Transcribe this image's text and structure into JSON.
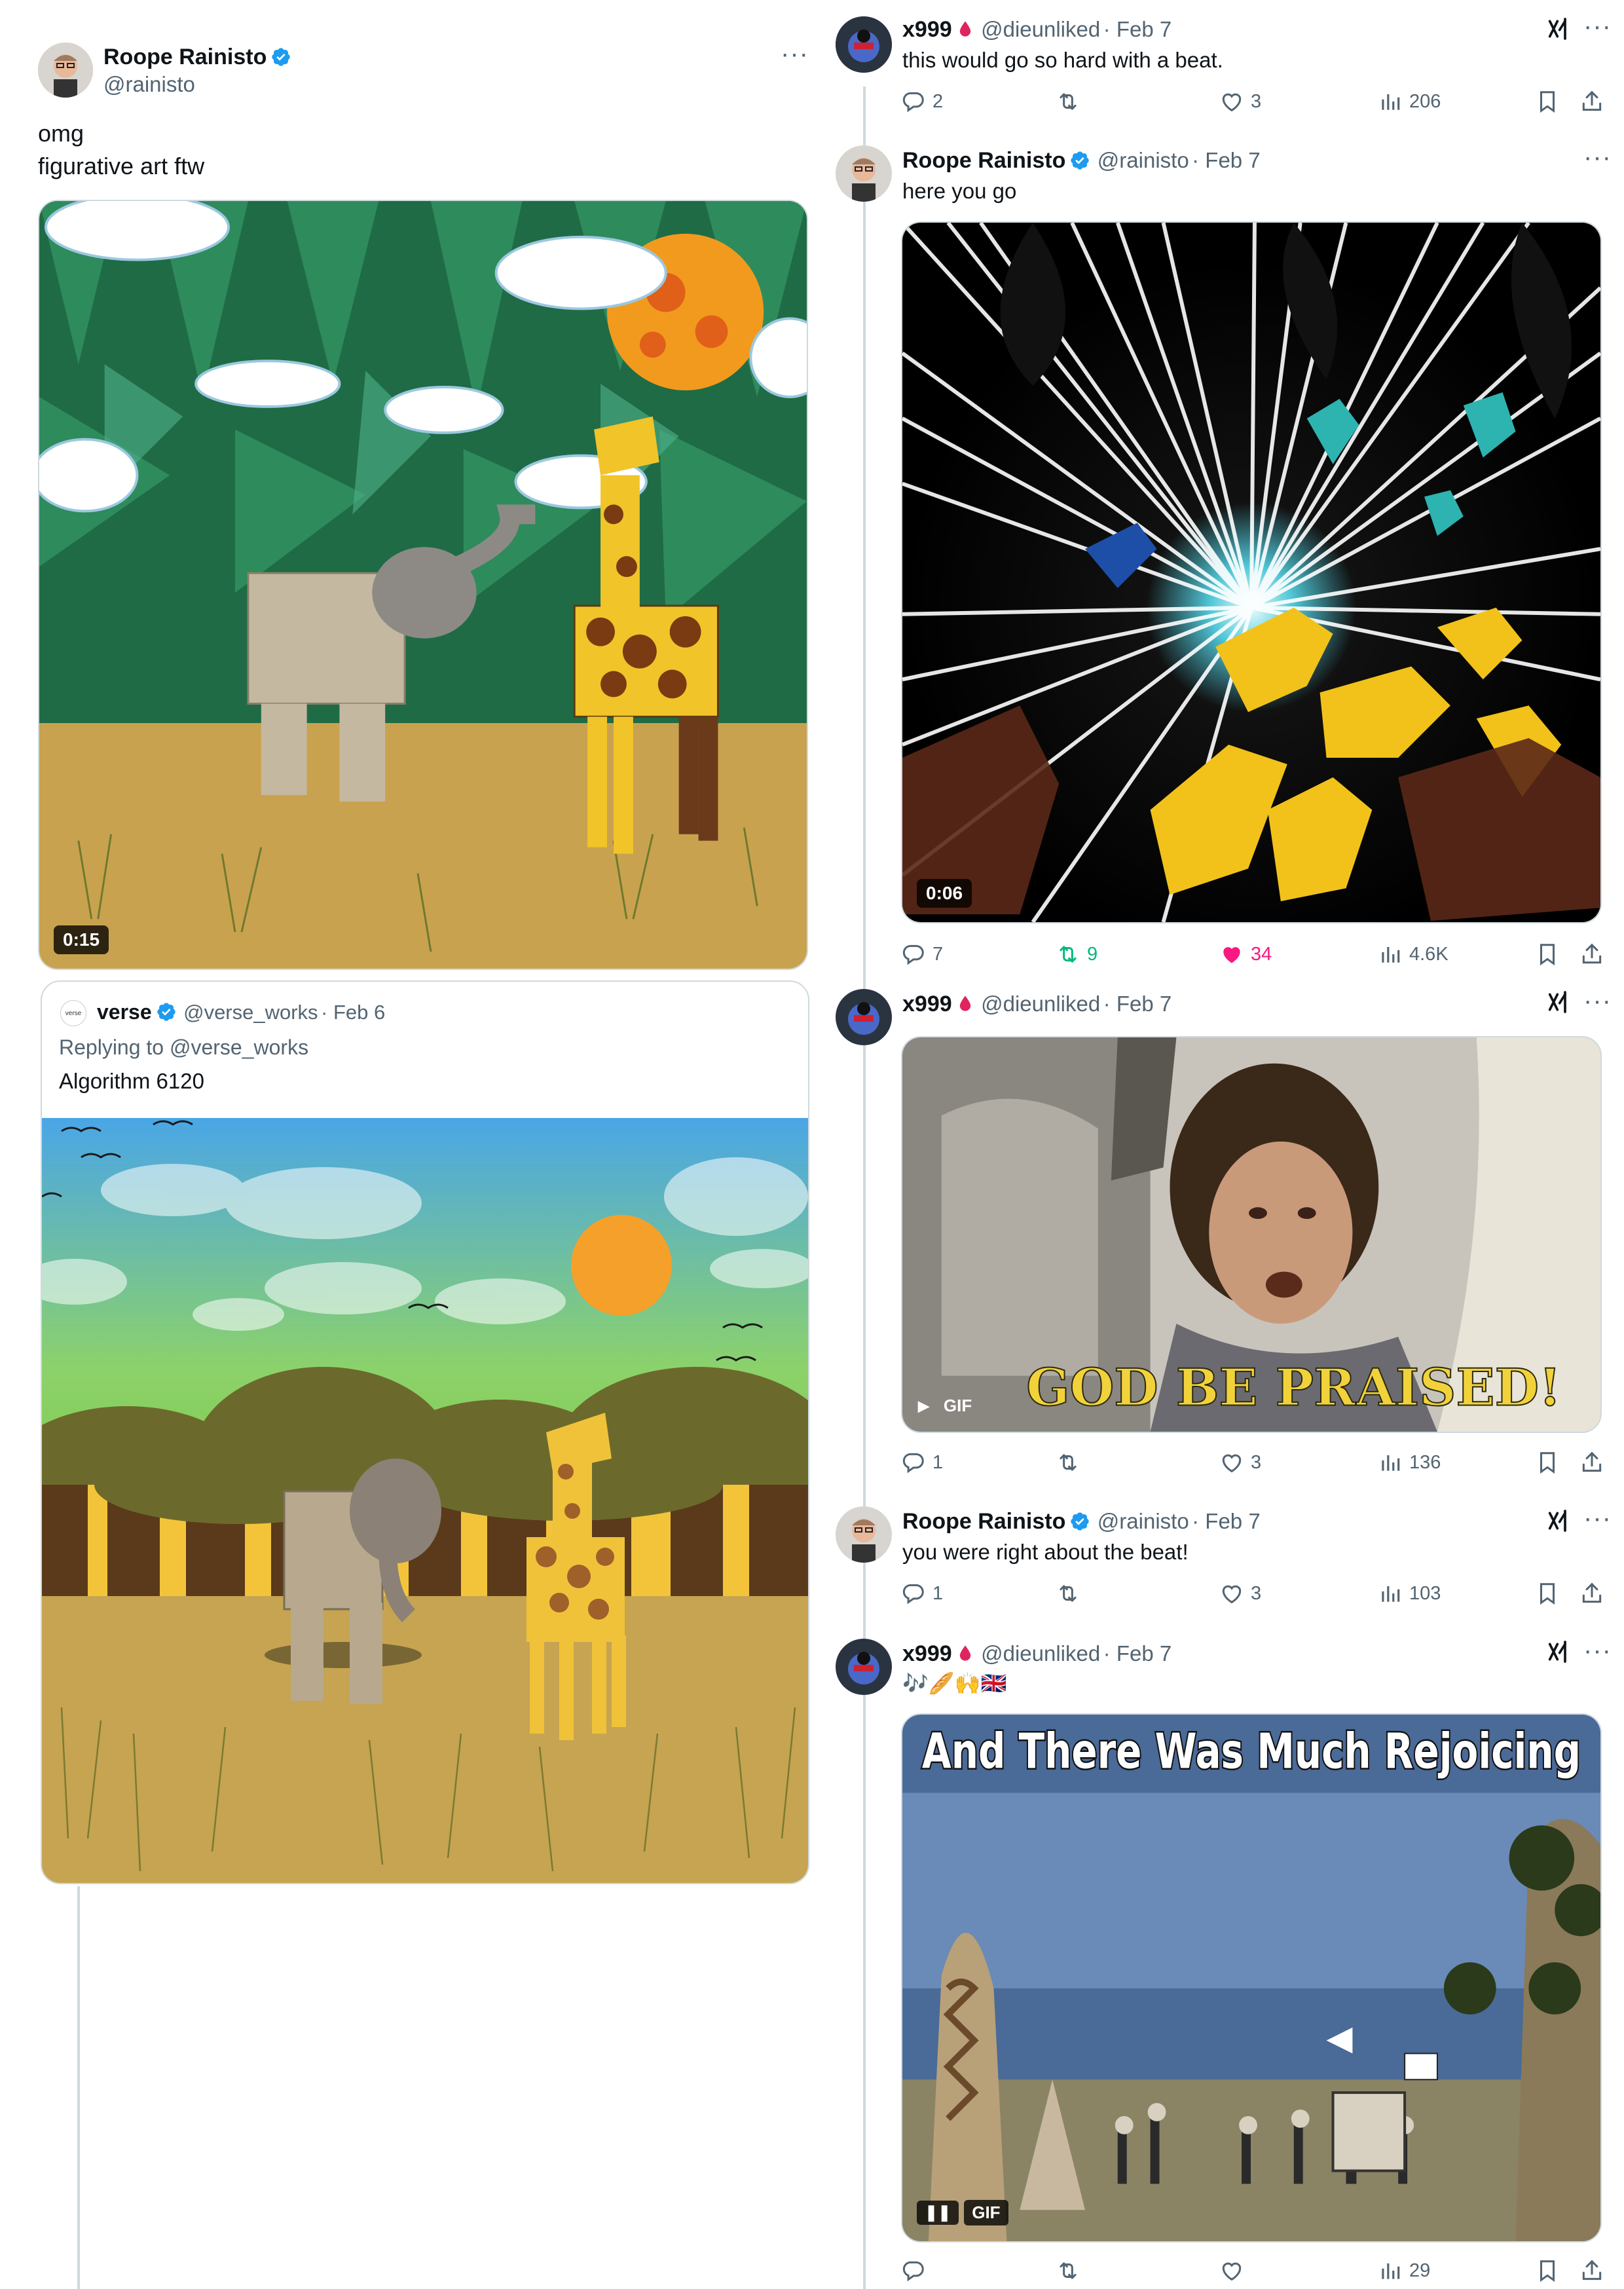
{
  "left_post": {
    "author_name": "Roope Rainisto",
    "author_handle": "@rainisto",
    "text_line1": "omg",
    "text_line2": "figurative art ftw",
    "video_duration": "0:15",
    "quote": {
      "logo_text": "verse",
      "author_name": "verse",
      "author_handle": "@verse_works",
      "date": "· Feb 6",
      "replying_to": "Replying to @verse_works",
      "text": "Algorithm 6120"
    }
  },
  "thread": [
    {
      "author_name": "x999",
      "author_handle": "@dieunliked",
      "date": "· Feb 7",
      "text": "this would go so hard with a beat.",
      "stats": {
        "replies": "2",
        "reposts": "",
        "likes": "3",
        "views": "206"
      }
    },
    {
      "author_name": "Roope Rainisto",
      "author_handle": "@rainisto",
      "date": "· Feb 7",
      "text": "here you go",
      "video_duration": "0:06",
      "stats": {
        "replies": "7",
        "reposts": "9",
        "likes": "34",
        "views": "4.6K"
      }
    },
    {
      "author_name": "x999",
      "author_handle": "@dieunliked",
      "date": "· Feb 7",
      "gif_label": "GIF",
      "gif_caption": "GOD BE PRAISED!",
      "stats": {
        "replies": "1",
        "reposts": "",
        "likes": "3",
        "views": "136"
      }
    },
    {
      "author_name": "Roope Rainisto",
      "author_handle": "@rainisto",
      "date": "· Feb 7",
      "text": "you were right about the beat!",
      "stats": {
        "replies": "1",
        "reposts": "",
        "likes": "3",
        "views": "103"
      }
    },
    {
      "author_name": "x999",
      "author_handle": "@dieunliked",
      "date": "· Feb 7",
      "text": "🎶🥖🙌🇬🇧",
      "gif_label": "GIF",
      "gif_caption": "And There Was Much Rejoicing",
      "stats": {
        "replies": "",
        "reposts": "",
        "likes": "",
        "views": "29"
      }
    }
  ],
  "colors": {
    "verified": "#1d9bf0",
    "repost_active": "#00ba7c",
    "like_active": "#f91880",
    "text_secondary": "#536471",
    "drop": "#e0245e"
  },
  "icons": [
    "verified-icon",
    "reply-icon",
    "repost-icon",
    "like-icon",
    "views-icon",
    "bookmark-icon",
    "share-icon",
    "more-icon",
    "grok-icon",
    "blood-drop-icon",
    "play-icon",
    "pause-icon"
  ]
}
